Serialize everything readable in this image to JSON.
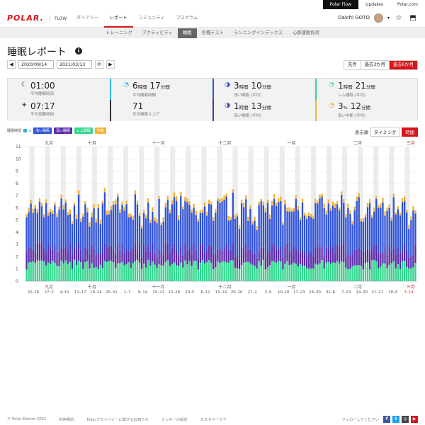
{
  "topbar": {
    "links": [
      "Polar Flow",
      "Updates",
      "Polar.com"
    ]
  },
  "header": {
    "logo": "POLAR.",
    "flow_label": "FLOW",
    "nav": [
      "ダイアリー",
      "レポート",
      "コミュニティ",
      "プログラム"
    ],
    "user_name": "Daichi GOTO"
  },
  "subnav": [
    "トレーニング",
    "アクティビティ",
    "睡眠",
    "各種テスト",
    "ランニングインデックス",
    "心肺運動負荷"
  ],
  "page": {
    "title": "睡眠レポート",
    "date_from": "2020/09/14",
    "date_to": "2021/03/13",
    "range_options": [
      "先月",
      "過去3か月",
      "過去6か月"
    ]
  },
  "summary": {
    "avg_sleep_time": {
      "value": "01:00",
      "label": "平均睡眠時刻"
    },
    "avg_wake_time": {
      "value": "07:17",
      "label": "平均覚醒時刻"
    },
    "avg_duration": {
      "h": "6",
      "h_unit": "時間",
      "m": "17",
      "m_unit": "分間",
      "label": "平均睡眠時間"
    },
    "avg_score": {
      "value": "71",
      "label": "平均睡眠スコア"
    },
    "light_sleep": {
      "h": "3",
      "h_unit": "時間",
      "m": "10",
      "m_unit": "分間",
      "label": "浅い睡眠 (平均)"
    },
    "deep_sleep": {
      "h": "1",
      "h_unit": "時間",
      "m": "13",
      "m_unit": "分間",
      "label": "深い睡眠 (平均)"
    },
    "rem_sleep": {
      "h": "1",
      "h_unit": "時間",
      "m": "21",
      "m_unit": "分間",
      "label": "レム睡眠 (平均)"
    },
    "interruptions": {
      "pct": "3",
      "pct_unit": "%",
      "m": "12",
      "m_unit": "分間",
      "label": "長い中断 (平均)"
    }
  },
  "legend": {
    "prefix": "睡眠時間",
    "x_label": "x",
    "items": [
      "浅い睡眠",
      "深い睡眠",
      "レム睡眠",
      "中断"
    ]
  },
  "sort": {
    "label": "表示順",
    "options": [
      "タイミング",
      "時間"
    ]
  },
  "colors": {
    "brand": "#d7141a",
    "light": "#2f52d9",
    "deep": "#5a2aa8",
    "rem": "#33d68e",
    "interrupt": "#f3b234",
    "unknown": "#2fb6d9"
  },
  "chart_data": {
    "type": "bar",
    "stacked": true,
    "ylim": [
      0,
      11
    ],
    "yticks": [
      0,
      1,
      2,
      3,
      4,
      5,
      6,
      7,
      8,
      9,
      10,
      11
    ],
    "months": [
      "九月",
      "十月",
      "十一月",
      "十二月",
      "一月",
      "二月",
      "三月"
    ],
    "week_labels": [
      "20–26",
      "27–3",
      "4–10",
      "11–17",
      "18–24",
      "25–31",
      "1–7",
      "8–14",
      "15–21",
      "22–28",
      "29–5",
      "6–12",
      "13–19",
      "20–26",
      "27–2",
      "3–9",
      "10–16",
      "17–23",
      "24–30",
      "31–6",
      "7–13",
      "14–20",
      "21–27",
      "28–6",
      "7–13"
    ],
    "series": [
      {
        "name": "レム睡眠",
        "mean": 1.35
      },
      {
        "name": "深い睡眠",
        "mean": 1.2
      },
      {
        "name": "浅い睡眠",
        "mean": 3.2
      },
      {
        "name": "中断",
        "mean": 0.3
      }
    ]
  },
  "footer": {
    "links": [
      "© Polar Electro 2021",
      "利用規約",
      "Polarプライバシーに関するお知らせ",
      "クッキーの設定",
      "カスタマーケア"
    ],
    "follow": "フォローしてください"
  }
}
